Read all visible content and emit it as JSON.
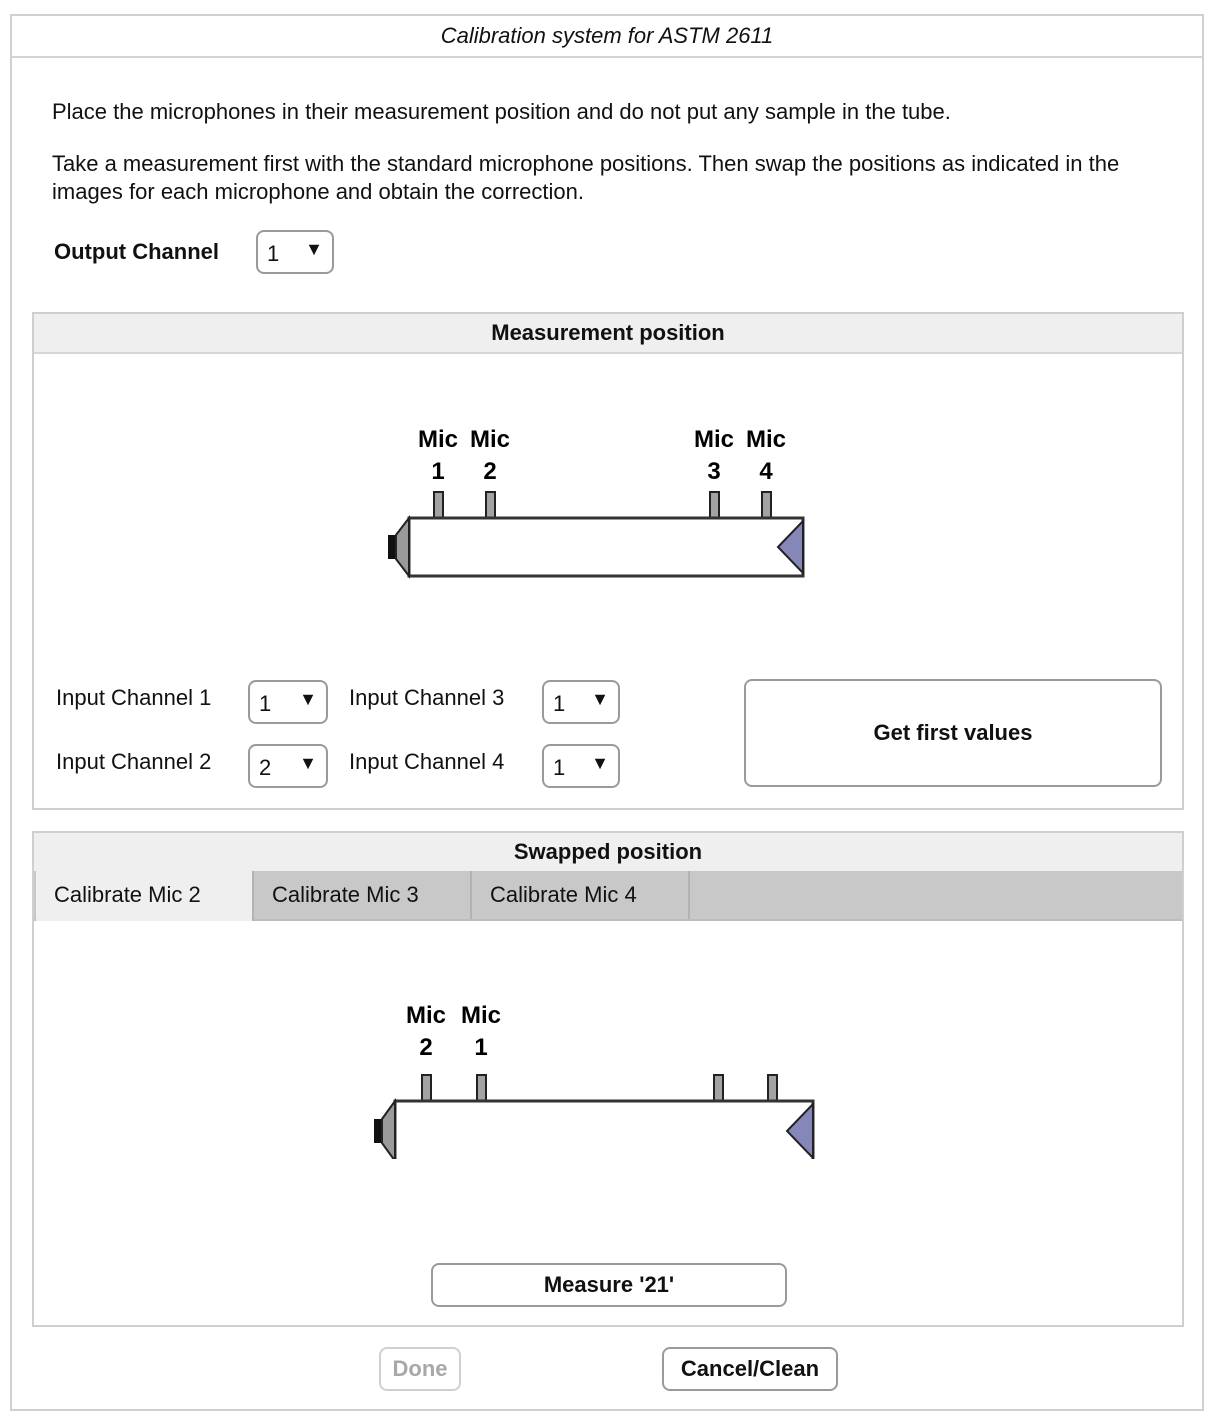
{
  "window": {
    "title": "Calibration system for ASTM 2611"
  },
  "instructions": {
    "line1": "Place the microphones in their measurement position and do not put any sample in the tube.",
    "line2": "Take a measurement first with the standard microphone positions. Then swap the positions as indicated in the images for each microphone and obtain the correction."
  },
  "output_channel": {
    "label": "Output Channel",
    "value": "1"
  },
  "measurement": {
    "header": "Measurement position",
    "diagram": {
      "mic_labels": [
        {
          "top": "Mic",
          "bottom": "1"
        },
        {
          "top": "Mic",
          "bottom": "2"
        },
        {
          "top": "Mic",
          "bottom": "3"
        },
        {
          "top": "Mic",
          "bottom": "4"
        }
      ]
    },
    "inputs": [
      {
        "label": "Input Channel 1",
        "value": "1"
      },
      {
        "label": "Input Channel 2",
        "value": "2"
      },
      {
        "label": "Input Channel 3",
        "value": "1"
      },
      {
        "label": "Input Channel 4",
        "value": "1"
      }
    ],
    "get_first_values_label": "Get first values"
  },
  "swapped": {
    "header": "Swapped position",
    "tabs": [
      {
        "label": "Calibrate Mic 2",
        "active": true
      },
      {
        "label": "Calibrate Mic 3",
        "active": false
      },
      {
        "label": "Calibrate Mic 4",
        "active": false
      }
    ],
    "diagram": {
      "mic_labels": [
        {
          "top": "Mic",
          "bottom": "2"
        },
        {
          "top": "Mic",
          "bottom": "1"
        }
      ]
    },
    "measure_label": "Measure '21'"
  },
  "footer": {
    "done_label": "Done",
    "done_enabled": false,
    "cancel_label": "Cancel/Clean"
  },
  "colors": {
    "speaker_gray": "#9a9a9a",
    "termination_blue": "#8587b8",
    "mic_gray": "#a3a3a3"
  }
}
